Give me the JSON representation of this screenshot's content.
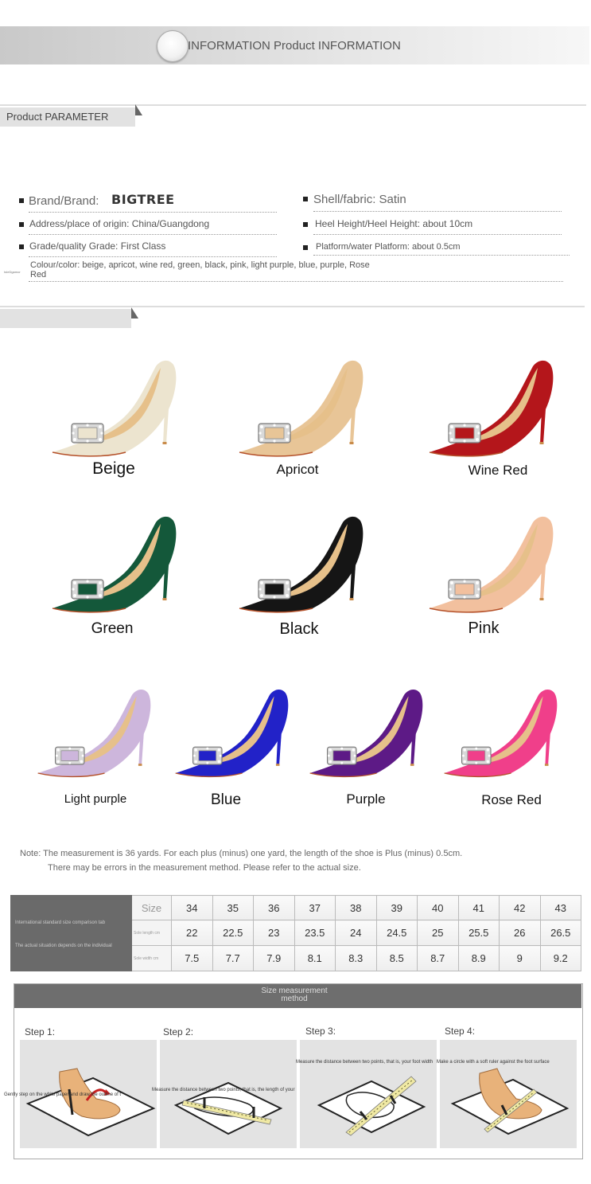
{
  "header": {
    "title": "INFORMATION Product INFORMATION"
  },
  "parameter": {
    "tab_label": "Product PARAMETER",
    "brand_label": "Brand/Brand:",
    "brand_logo": "BIGTREE",
    "address": "Address/place of origin: China/Guangdong",
    "grade": "Grade/quality Grade: First Class",
    "colour_line1": "Colour/color: beige, apricot, wine red, green, black, pink, light purple, blue, purple, Rose",
    "colour_line2": "Red",
    "shell": "Shell/fabric: Satin",
    "heel": "Heel Height/Heel Height: about 10cm",
    "platform": "Platform/water Platform: about 0.5cm",
    "tiny_tag": "IsIeDgamor"
  },
  "colors": {
    "row1": [
      {
        "label": "Beige",
        "hex": "#ece4cf"
      },
      {
        "label": "Apricot",
        "hex": "#e8c597"
      },
      {
        "label": "Wine Red",
        "hex": "#b4161b"
      }
    ],
    "row2": [
      {
        "label": "Green",
        "hex": "#14583a"
      },
      {
        "label": "Black",
        "hex": "#151515"
      },
      {
        "label": "Pink",
        "hex": "#f2c09e"
      }
    ],
    "row3": [
      {
        "label": "Light purple",
        "hex": "#cdb6dc"
      },
      {
        "label": "Blue",
        "hex": "#2222c8"
      },
      {
        "label": "Purple",
        "hex": "#5d1a86"
      },
      {
        "label": "Rose Red",
        "hex": "#f03f8a"
      }
    ]
  },
  "note": {
    "line1": "Note: The measurement is 36 yards. For each plus (minus) one yard, the length of the shoe is Plus (minus) 0.5cm.",
    "line2": "There may be errors in the measurement method. Please refer to the actual size."
  },
  "size_table": {
    "side_title": "International standard size comparison tab",
    "side_note": "The actual situation depends on the individual",
    "row_labels": [
      "Size",
      "Sole length cm",
      "Sole width cm"
    ],
    "sizes": [
      "34",
      "35",
      "36",
      "37",
      "38",
      "39",
      "40",
      "41",
      "42",
      "43"
    ],
    "lengths": [
      "22",
      "22.5",
      "23",
      "23.5",
      "24",
      "24.5",
      "25",
      "25.5",
      "26",
      "26.5"
    ],
    "widths": [
      "7.5",
      "7.7",
      "7.9",
      "8.1",
      "8.3",
      "8.5",
      "8.7",
      "8.9",
      "9",
      "9.2"
    ]
  },
  "measure": {
    "title_line1": "Size measurement",
    "title_line2": "method",
    "steps": [
      {
        "label": "Step 1:",
        "text": "Gently step on the white paper and draw the outline of t"
      },
      {
        "label": "Step 2:",
        "text": "Measure the distance between two points, that is, the length of your"
      },
      {
        "label": "Step 3:",
        "text": "Measure the distance between two points, that is, your foot width"
      },
      {
        "label": "Step 4:",
        "text": "Make a circle with a soft ruler against the foot surface"
      }
    ]
  }
}
